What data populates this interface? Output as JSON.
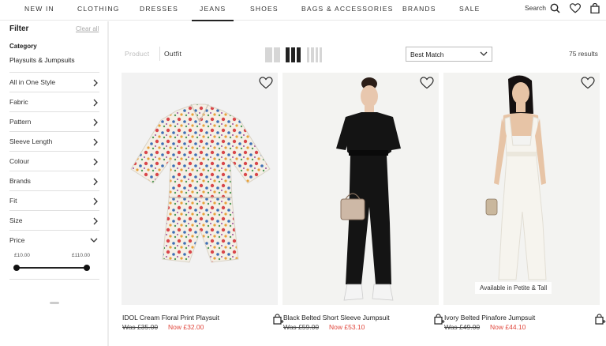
{
  "nav": {
    "items": [
      "NEW IN",
      "CLOTHING",
      "DRESSES",
      "JEANS",
      "SHOES",
      "BAGS & ACCESSORIES",
      "BRANDS",
      "SALE"
    ],
    "active": "JEANS",
    "search_label": "Search"
  },
  "filter": {
    "title": "Filter",
    "clear_all": "Clear all",
    "category_title": "Category",
    "category_value": "Playsuits & Jumpsuits",
    "facets": [
      "All in One Style",
      "Fabric",
      "Pattern",
      "Sleeve Length",
      "Colour",
      "Brands",
      "Fit",
      "Size",
      "Price"
    ],
    "price_min": "£10.00",
    "price_max": "£110.00"
  },
  "toolbar": {
    "tab_product": "Product",
    "tab_outfit": "Outfit",
    "sort": "Best Match",
    "results": "75 results"
  },
  "products": [
    {
      "name": "IDOL Cream Floral Print Playsuit",
      "was": "Was £35.00",
      "now": "Now £32.00",
      "badge": ""
    },
    {
      "name": "Black Belted Short Sleeve Jumpsuit",
      "was": "Was £59.00",
      "now": "Now £53.10",
      "badge": ""
    },
    {
      "name": "Ivory Belted Pinafore Jumpsuit",
      "was": "Was £49.00",
      "now": "Now £44.10",
      "badge": "Available in Petite & Tall"
    }
  ],
  "colors": {
    "sale_red": "#e0463c",
    "text": "#222222",
    "divider": "#e0e0e0"
  }
}
